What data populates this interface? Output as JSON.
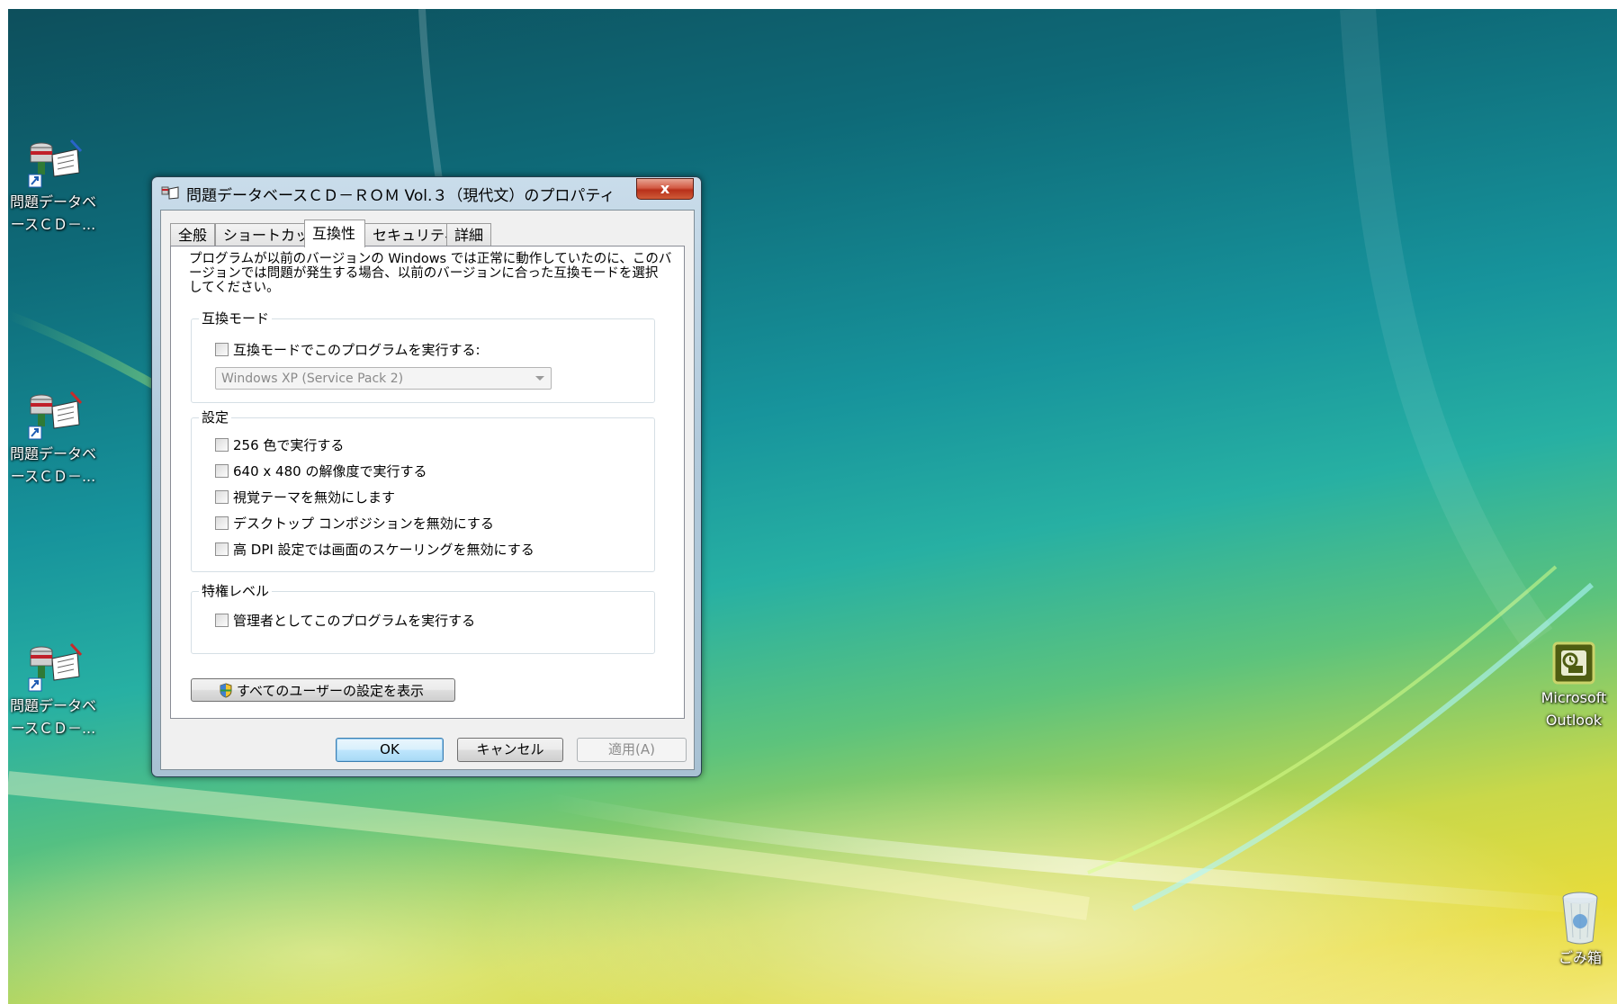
{
  "desktop": {
    "icons_left": [
      {
        "label_line1": "問題データベ",
        "label_line2": "ースＣＤ－..."
      },
      {
        "label_line1": "問題データベ",
        "label_line2": "ースＣＤ－..."
      },
      {
        "label_line1": "問題データベ",
        "label_line2": "ースＣＤ－..."
      }
    ],
    "outlook": {
      "label_line1": "Microsoft",
      "label_line2": "Outlook"
    },
    "recycle": {
      "label": "ごみ箱"
    }
  },
  "dialog": {
    "title": "問題データベースＣＤ－ＲＯＭ Vol.３（現代文）のプロパティ",
    "close_glyph": "x",
    "tabs": [
      {
        "label": "全般"
      },
      {
        "label": "ショートカット"
      },
      {
        "label": "互換性"
      },
      {
        "label": "セキュリティ"
      },
      {
        "label": "詳細"
      }
    ],
    "description_line1": "プログラムが以前のバージョンの Windows では正常に動作していたのに、このバ",
    "description_line2": "ージョンでは問題が発生する場合、以前のバージョンに合った互換モードを選択",
    "description_line3": "してください。",
    "compat_group": {
      "legend": "互換モード",
      "checkbox_label": "互換モードでこのプログラムを実行する:",
      "select_value": "Windows XP (Service Pack 2)"
    },
    "settings_group": {
      "legend": "設定",
      "options": [
        {
          "label": "256 色で実行する"
        },
        {
          "label": "640 x 480 の解像度で実行する"
        },
        {
          "label": "視覚テーマを無効にします"
        },
        {
          "label": "デスクトップ コンポジションを無効にする"
        },
        {
          "label": "高 DPI 設定では画面のスケーリングを無効にする"
        }
      ]
    },
    "privilege_group": {
      "legend": "特権レベル",
      "checkbox_label": "管理者としてこのプログラムを実行する"
    },
    "all_users_button": "すべてのユーザーの設定を表示",
    "ok_button": "OK",
    "cancel_button": "キャンセル",
    "apply_button": "適用(A)"
  }
}
